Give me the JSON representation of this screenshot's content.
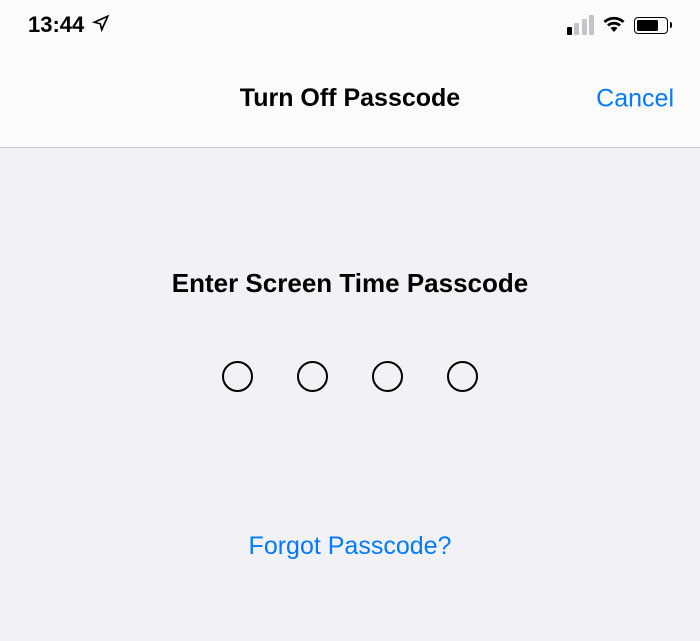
{
  "status_bar": {
    "time": "13:44"
  },
  "nav": {
    "title": "Turn Off Passcode",
    "cancel_label": "Cancel"
  },
  "content": {
    "prompt": "Enter Screen Time Passcode",
    "forgot_label": "Forgot Passcode?"
  }
}
